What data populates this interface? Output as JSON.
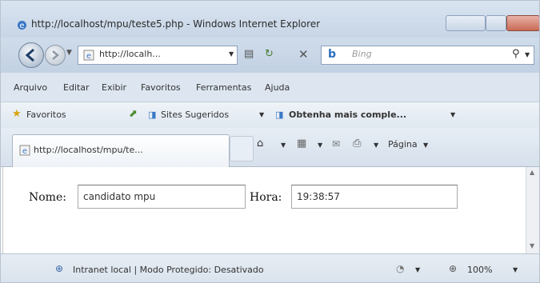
{
  "window": {
    "title": "http://localhost/mpu/teste5.php - Windows Internet Explorer"
  },
  "address_bar": {
    "url": "http://localh...",
    "search_placeholder": "Bing"
  },
  "menu": {
    "items": [
      "Arquivo",
      "Editar",
      "Exibir",
      "Favoritos",
      "Ferramentas",
      "Ajuda"
    ]
  },
  "favorites_bar": {
    "favorites_label": "Favoritos",
    "suggested_sites": "Sites Sugeridos",
    "get_more": "Obtenha mais comple..."
  },
  "tabs": [
    {
      "label": "http://localhost/mpu/te..."
    }
  ],
  "command_bar": {
    "page_label": "Página"
  },
  "form": {
    "nome_label": "Nome:",
    "nome_value": "candidato mpu",
    "hora_label": "Hora:",
    "hora_value": "19:38:57"
  },
  "status_bar": {
    "zone_text": "Intranet local | Modo Protegido: Desativado",
    "zoom": "100%"
  }
}
